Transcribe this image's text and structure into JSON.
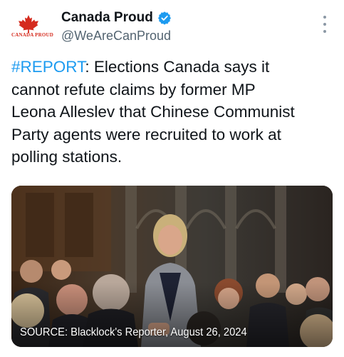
{
  "account": {
    "display_name": "Canada Proud",
    "handle": "@WeAreCanProud",
    "avatar_text": "CANADA PROUD",
    "verified": true
  },
  "tweet": {
    "hashtag": "#REPORT",
    "text": ": Elections Canada says it\ncannot refute claims by former MP\nLeona Alleslev that Chinese Communist\nParty agents were recruited to work at\npolling stations."
  },
  "media": {
    "caption": "SOURCE: Blacklock's Reporter, August 26, 2024"
  },
  "icons": [
    "maple-leaf-icon",
    "verified-badge-icon",
    "more-options-icon"
  ],
  "colors": {
    "hashtag": "#1d9bf0",
    "verified": "#1d9bf0",
    "brand_red": "#d52b1e",
    "handle": "#536471"
  }
}
